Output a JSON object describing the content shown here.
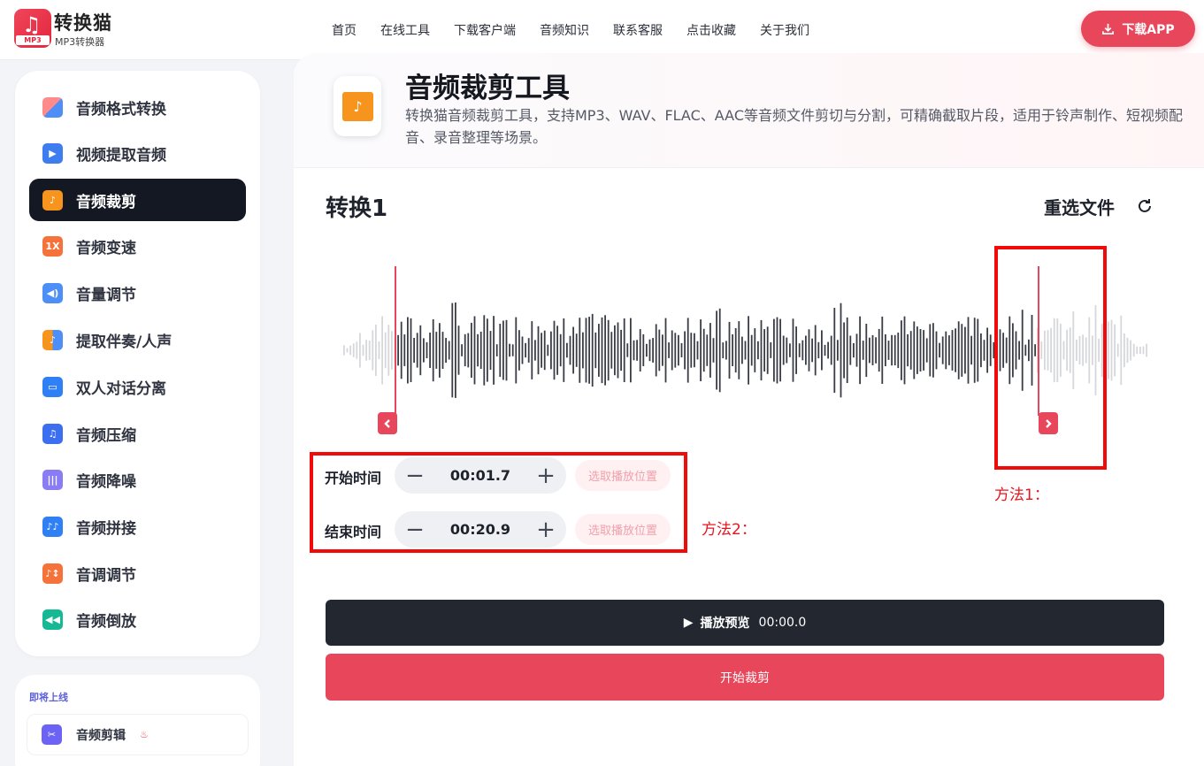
{
  "header": {
    "logo_name": "转换猫",
    "logo_sub": "MP3转换器",
    "logo_tag": "MP3",
    "nav": [
      "首页",
      "在线工具",
      "下载客户端",
      "音频知识",
      "联系客服",
      "点击收藏",
      "关于我们"
    ],
    "download_label": "下载APP"
  },
  "sidebar": {
    "items": [
      {
        "label": "音频格式转换",
        "icon": "format-convert-icon",
        "active": false
      },
      {
        "label": "视频提取音频",
        "icon": "video-extract-icon",
        "active": false
      },
      {
        "label": "音频裁剪",
        "icon": "audio-trim-icon",
        "active": true
      },
      {
        "label": "音频变速",
        "icon": "speed-1x-icon",
        "active": false
      },
      {
        "label": "音量调节",
        "icon": "volume-icon",
        "active": false
      },
      {
        "label": "提取伴奏/人声",
        "icon": "vocal-extract-icon",
        "active": false
      },
      {
        "label": "双人对话分离",
        "icon": "dialog-split-icon",
        "active": false
      },
      {
        "label": "音频压缩",
        "icon": "compress-icon",
        "active": false
      },
      {
        "label": "音频降噪",
        "icon": "denoise-icon",
        "active": false
      },
      {
        "label": "音频拼接",
        "icon": "merge-icon",
        "active": false
      },
      {
        "label": "音调调节",
        "icon": "pitch-icon",
        "active": false
      },
      {
        "label": "音频倒放",
        "icon": "reverse-icon",
        "active": false
      }
    ],
    "speed_badge": "1X",
    "soon_title": "即将上线",
    "soon_item": "音频剪辑"
  },
  "tool": {
    "title": "音频裁剪工具",
    "description": "转换猫音频裁剪工具，支持MP3、WAV、FLAC、AAC等音频文件剪切与分割，可精确截取片段，适用于铃声制作、短视频配音、录音整理等场景。"
  },
  "workspace": {
    "title": "转换1",
    "reselect_label": "重选文件",
    "start_label": "开始时间",
    "start_value": "00:01.7",
    "end_label": "结束时间",
    "end_value": "00:20.9",
    "pick_label": "选取播放位置",
    "play_label": "播放预览",
    "play_time": "00:00.0",
    "cut_label": "开始裁剪",
    "annotation_1": "方法1：",
    "annotation_2": "方法2："
  },
  "colors": {
    "accent": "#e8465a",
    "dark": "#141823",
    "annotation_red": "#f00a0a"
  }
}
